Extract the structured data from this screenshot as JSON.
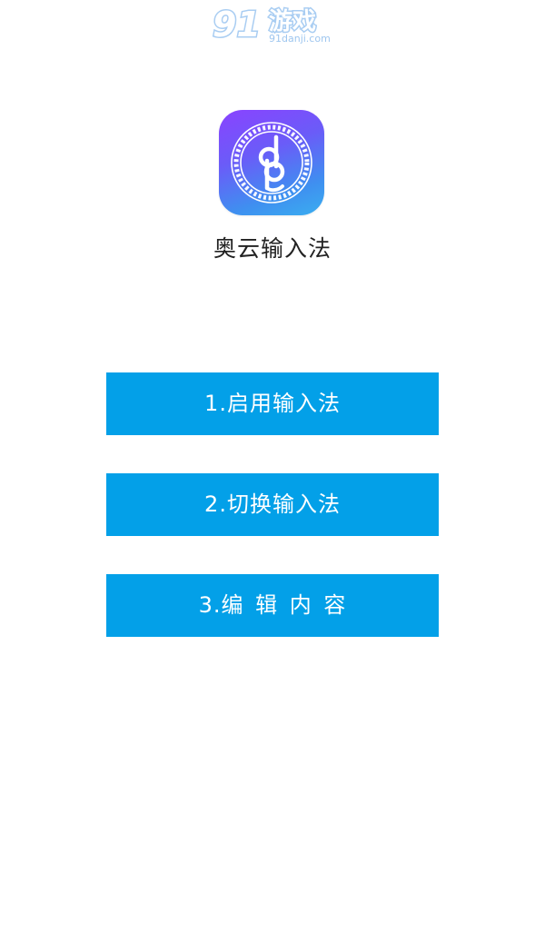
{
  "watermark": {
    "logo_number": "91",
    "logo_text": "游戏",
    "site": "91danji.com"
  },
  "app": {
    "name": "奥云输入法",
    "icon": "aoyun-input-logo-icon"
  },
  "buttons": [
    {
      "label": "1.启用输入法"
    },
    {
      "label": "2.切换输入法"
    },
    {
      "label": "3.编 辑 内 容"
    }
  ],
  "colors": {
    "button_bg": "#03a0e8",
    "button_text": "#ffffff",
    "icon_gradient_start": "#8a43ff",
    "icon_gradient_end": "#3aaef0",
    "watermark": "#a9cdf2"
  }
}
